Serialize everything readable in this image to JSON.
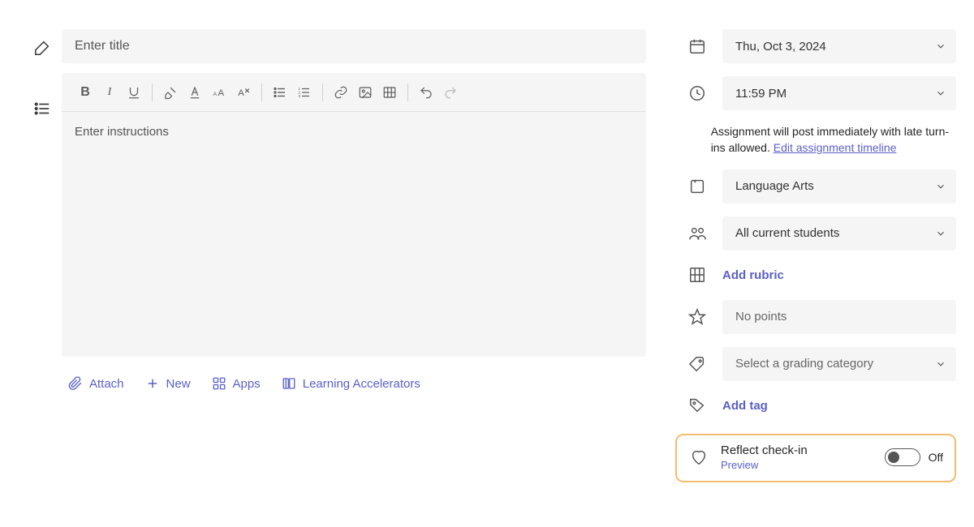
{
  "title": {
    "placeholder": "Enter title"
  },
  "instructions": {
    "placeholder": "Enter instructions"
  },
  "actions": {
    "attach": "Attach",
    "new": "New",
    "apps": "Apps",
    "accelerators": "Learning Accelerators"
  },
  "sidebar": {
    "date": "Thu, Oct 3, 2024",
    "time": "11:59 PM",
    "note_prefix": "Assignment will post immediately with late turn-ins allowed. ",
    "note_link": "Edit assignment timeline",
    "class": "Language Arts",
    "students": "All current students",
    "rubric_link": "Add rubric",
    "points": "No points",
    "grading_category_placeholder": "Select a grading category",
    "tag_link": "Add tag",
    "reflect": {
      "title": "Reflect check-in",
      "badge": "Preview",
      "state": "Off"
    }
  }
}
